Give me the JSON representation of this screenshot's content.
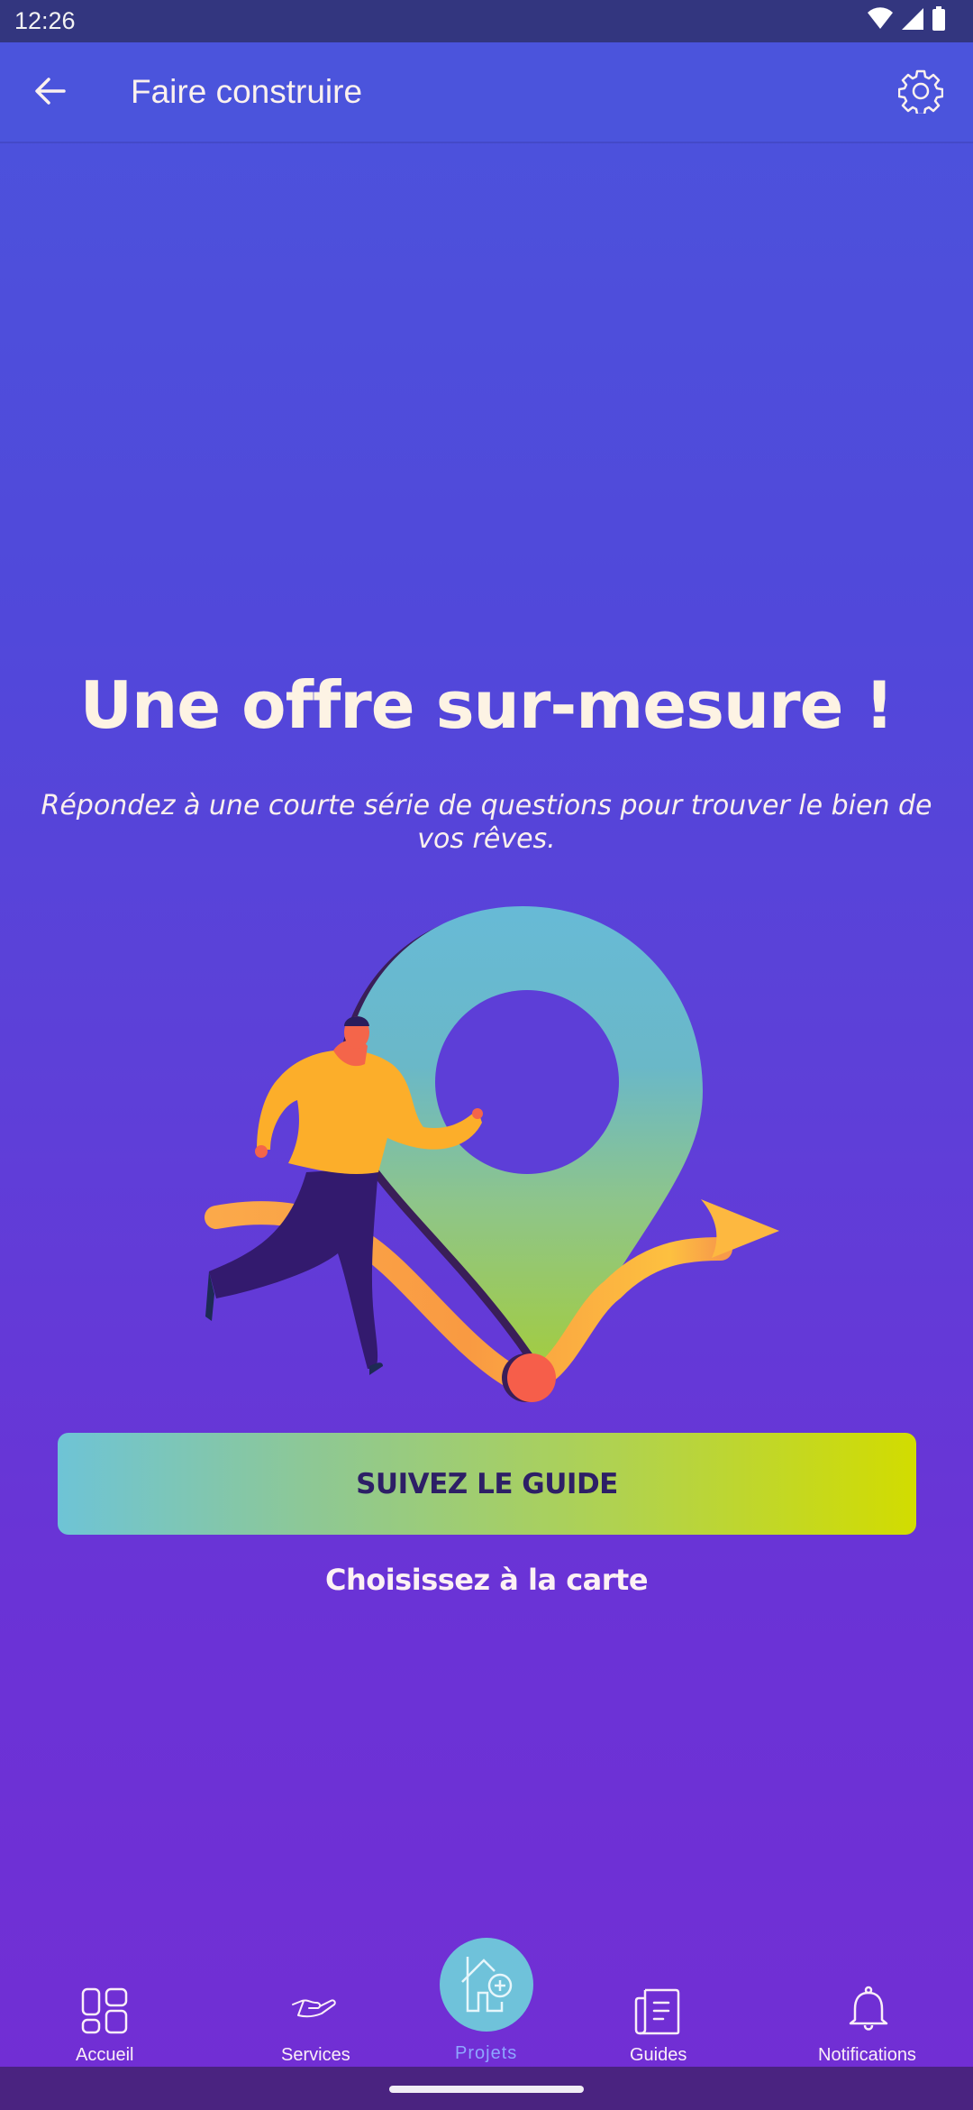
{
  "status_bar": {
    "time": "12:26",
    "icons": [
      "wifi-icon",
      "signal-icon",
      "battery-icon"
    ]
  },
  "app_bar": {
    "title": "Faire construire",
    "back_icon": "arrow-left-icon",
    "settings_icon": "gear-icon"
  },
  "main": {
    "headline": "Une offre sur-mesure !",
    "subtitle": "Répondez à une courte série de questions pour trouver le bien de vos rêves.",
    "illustration": "person-running-to-map-pin-illustration",
    "primary_button": "SUIVEZ LE GUIDE",
    "secondary_link": "Choisissez à la carte"
  },
  "bottom_nav": {
    "items": [
      {
        "label": "Accueil",
        "icon": "grid-icon",
        "active": false
      },
      {
        "label": "Services",
        "icon": "hand-icon",
        "active": false
      },
      {
        "label": "Projets",
        "icon": "house-plus-icon",
        "active": true
      },
      {
        "label": "Guides",
        "icon": "document-icon",
        "active": false
      },
      {
        "label": "Notifications",
        "icon": "bell-icon",
        "active": false
      }
    ]
  },
  "colors": {
    "status_bar": "#33367f",
    "app_bar": "#4b54dc",
    "background_top": "#4b54dc",
    "background_bottom": "#722ed4",
    "headline": "#fdf3e4",
    "button_gradient_start": "#6ec4d6",
    "button_gradient_end": "#d2dc00",
    "button_text": "#2d1f66",
    "nav_active_fab": "#6fc2da",
    "nav_active_label": "#8ea6ff"
  }
}
